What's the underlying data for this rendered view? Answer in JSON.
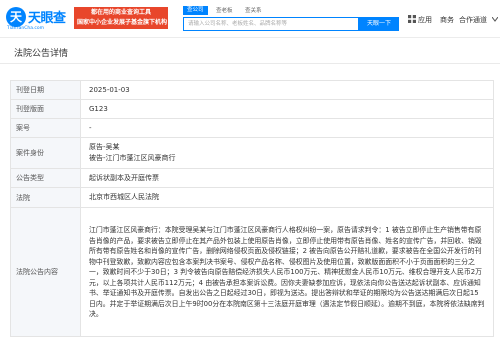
{
  "header": {
    "logo_mark": "天",
    "logo_name": "天眼查",
    "logo_url": "TianYanCha.com",
    "slogan_line1": "都在用的商业查询工具",
    "slogan_line2": "国家中小企业发展子基金旗下机构",
    "search_tabs": [
      "查公司",
      "查老板",
      "查关系"
    ],
    "search_placeholder": "请输入公司名称、老板姓名、品牌名称等",
    "search_button": "天眼一下",
    "nav_app": "应用",
    "nav_merchant": "商务",
    "nav_cooperation": "合作通道"
  },
  "page_title": "法院公告详情",
  "detail": {
    "rows": [
      {
        "key": "刊登日期",
        "value": "2025-01-03"
      },
      {
        "key": "刊登版面",
        "value": "G123"
      },
      {
        "key": "案号",
        "value": "-"
      },
      {
        "key": "案件身份",
        "value_lines": [
          "原告-吴某",
          "被告-江门市蓬江区风豪商行"
        ]
      },
      {
        "key": "公告类型",
        "value": "起诉状副本及开庭传票"
      },
      {
        "key": "法院",
        "value": "北京市西城区人民法院"
      },
      {
        "key": "法院公告内容",
        "value": "江门市蓬江区风豪商行：本院受理吴某与江门市蓬江区风豪商行人格权纠纷一案，原告请求判令：1 被告立即停止生产销售带有原告肖像的产品，要求被告立即停止在其产品外包装上使用原告肖像，立即停止使用带有原告肖像、姓名的宣传广告，并回收、销毁所有带有原告姓名和肖像的宣传广告，删除网络侵权页面及侵权链接；2 被告向原告公开赔礼道歉，要求被告在全国公开发行的刊物中刊登致歉，致歉内容应包含本案判决书案号、侵权产品名称、侵权图片及使用位置，致歉版面面积不小于页面面积的三分之一，致歉时间不少于30日；3 判令被告向原告赔偿经济损失人民币100万元、精神抚慰金人民币10万元、维权合理开支人民币2万元，以上各项共计人民币112万元；4 由被告承担本案诉讼费。因你夫妻缺参加应诉，现依法向你公告送达起诉状副本、应诉通知书、举证通知书及开庭传票。自发出公告之日起经过30日，即视为送达。提出答辩状和举证的期限均为公告送达期满后次日起15日内。并定于举证期满后次日上午9时00分在本院南区第十三法庭开庭审理（遇法定节假日顺延）。逾期不到庭，本院将依法缺席判决。"
      }
    ]
  }
}
